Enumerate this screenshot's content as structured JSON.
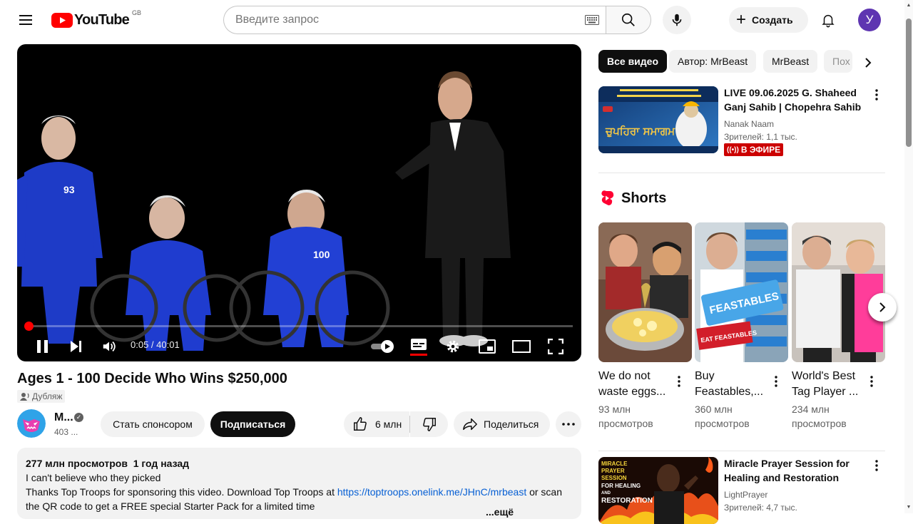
{
  "header": {
    "logo_text": "YouTube",
    "country_code": "GB",
    "search_placeholder": "Введите запрос",
    "create_label": "Создать",
    "avatar_letter": "У"
  },
  "player": {
    "time": "0:05 / 40:01",
    "progress_fraction": 0.002
  },
  "video": {
    "title": "Ages 1 - 100 Decide Who Wins $250,000",
    "dub_label": "Дубляж",
    "channel_name": "M...",
    "subscribers": "403 ...",
    "sponsor_label": "Стать спонсором",
    "subscribe_label": "Подписаться",
    "likes": "6 млн",
    "share_label": "Поделиться"
  },
  "description": {
    "views": "277 млн просмотров",
    "date": "1 год назад",
    "line1": "I can't believe who they picked",
    "line2_pre": "Thanks Top Troops for sponsoring this video. Download Top Troops at",
    "link": "https://toptroops.onelink.me/JHnC/mrbeast",
    "line2_post": "or scan",
    "line3": "the QR code to get a FREE special Starter Pack for a limited time",
    "more_label": "...ещё"
  },
  "chips": [
    "Все видео",
    "Автор: MrBeast",
    "MrBeast",
    "Пох"
  ],
  "recommendations": [
    {
      "title": "LIVE 09.06.2025 G. Shaheed Ganj Sahib | Chopehra Sahib |...",
      "channel": "Nanak Naam",
      "meta": "Зрителей: 1,1 тыс.",
      "badge": "В ЭФИРЕ"
    },
    {
      "title": "Miracle Prayer Session for Healing and Restoration with...",
      "channel": "LightPrayer",
      "meta": "Зрителей: 4,7 тыс."
    }
  ],
  "shorts": {
    "heading": "Shorts",
    "items": [
      {
        "title": "We do not waste eggs...",
        "views": "93 млн просмотров"
      },
      {
        "title": "Buy Feastables,...",
        "views": "360 млн просмотров"
      },
      {
        "title": "World's Best Tag Player ...",
        "views": "234 млн просмотров"
      }
    ]
  },
  "thumb_text": {
    "rec1_big": "ਚੁਪਹਿਰਾ ਸਮਾਗਮ",
    "rec2_lines": [
      "MIRACLE",
      "PRAYER",
      "SESSION",
      "FOR HEALING",
      "AND",
      "RESTORATION"
    ],
    "short2_brand": "FEASTABLES",
    "short2_eat": "EAT FEASTABLES",
    "jersey_number": "93",
    "jersey_number2": "100"
  },
  "colors": {
    "accent_red": "#ff0000",
    "live_red": "#cc0000",
    "link_blue": "#065fd4",
    "avatar_purple": "#5e35b1"
  }
}
